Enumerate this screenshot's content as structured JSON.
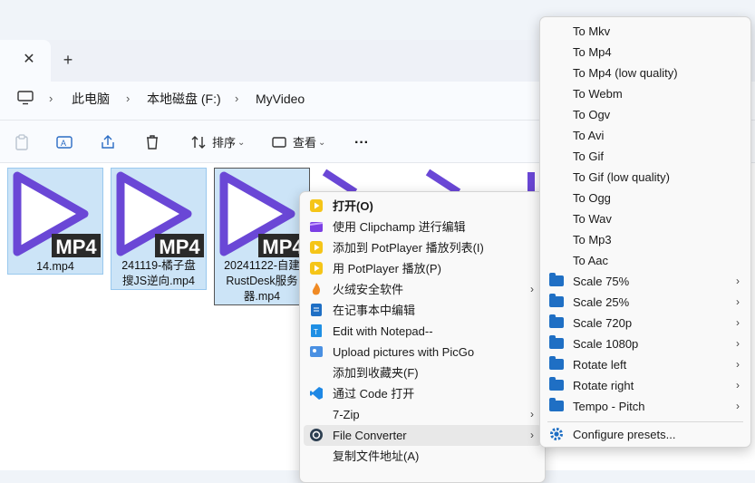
{
  "explorer": {
    "tab_close_icon": "close-icon",
    "tab_new_icon": "plus-icon",
    "breadcrumbs": [
      "此电脑",
      "本地磁盘 (F:)",
      "MyVideo"
    ],
    "toolbar": {
      "sort_label": "排序",
      "view_label": "查看",
      "more_label": "···"
    },
    "files": [
      {
        "name": "14.mp4",
        "badge": "MP4"
      },
      {
        "name": "241119-橘子盘\n搜JS逆向.mp4",
        "badge": "MP4"
      },
      {
        "name": "20241122-自建\nRustDesk服务\n器.mp4",
        "badge": "MP4"
      }
    ]
  },
  "context_menu": {
    "items": [
      {
        "label": "打开(O)",
        "icon": "potplayer-icon",
        "bold": true
      },
      {
        "label": "使用 Clipchamp 进行编辑",
        "icon": "clipchamp-icon"
      },
      {
        "label": "添加到 PotPlayer 播放列表(I)",
        "icon": "potplayer-icon"
      },
      {
        "label": "用 PotPlayer 播放(P)",
        "icon": "potplayer-icon"
      },
      {
        "label": "火绒安全软件",
        "icon": "huorong-icon",
        "submenu": true
      },
      {
        "label": "在记事本中编辑",
        "icon": "notepad-icon"
      },
      {
        "label": "Edit with Notepad--",
        "icon": "notepad-dash-icon"
      },
      {
        "label": "Upload pictures with PicGo",
        "icon": "picgo-icon"
      },
      {
        "label": "添加到收藏夹(F)",
        "icon": ""
      },
      {
        "label": "通过 Code 打开",
        "icon": "vscode-icon"
      },
      {
        "label": "7-Zip",
        "icon": "",
        "submenu": true
      },
      {
        "label": "File Converter",
        "icon": "file-converter-icon",
        "submenu": true,
        "highlighted": true
      },
      {
        "label": "复制文件地址(A)",
        "icon": ""
      }
    ]
  },
  "converter_menu": {
    "items": [
      {
        "label": "To Mkv"
      },
      {
        "label": "To Mp4"
      },
      {
        "label": "To Mp4 (low quality)"
      },
      {
        "label": "To Webm"
      },
      {
        "label": "To Ogv"
      },
      {
        "label": "To Avi"
      },
      {
        "label": "To Gif"
      },
      {
        "label": "To Gif (low quality)"
      },
      {
        "label": "To Ogg"
      },
      {
        "label": "To Wav"
      },
      {
        "label": "To Mp3"
      },
      {
        "label": "To Aac"
      },
      {
        "label": "Scale 75%",
        "folder": true
      },
      {
        "label": "Scale 25%",
        "folder": true
      },
      {
        "label": "Scale 720p",
        "folder": true
      },
      {
        "label": "Scale 1080p",
        "folder": true
      },
      {
        "label": "Rotate left",
        "folder": true
      },
      {
        "label": "Rotate right",
        "folder": true
      },
      {
        "label": "Tempo - Pitch",
        "folder": true
      }
    ],
    "configure_label": "Configure presets...",
    "configure_icon": "gear-icon"
  }
}
